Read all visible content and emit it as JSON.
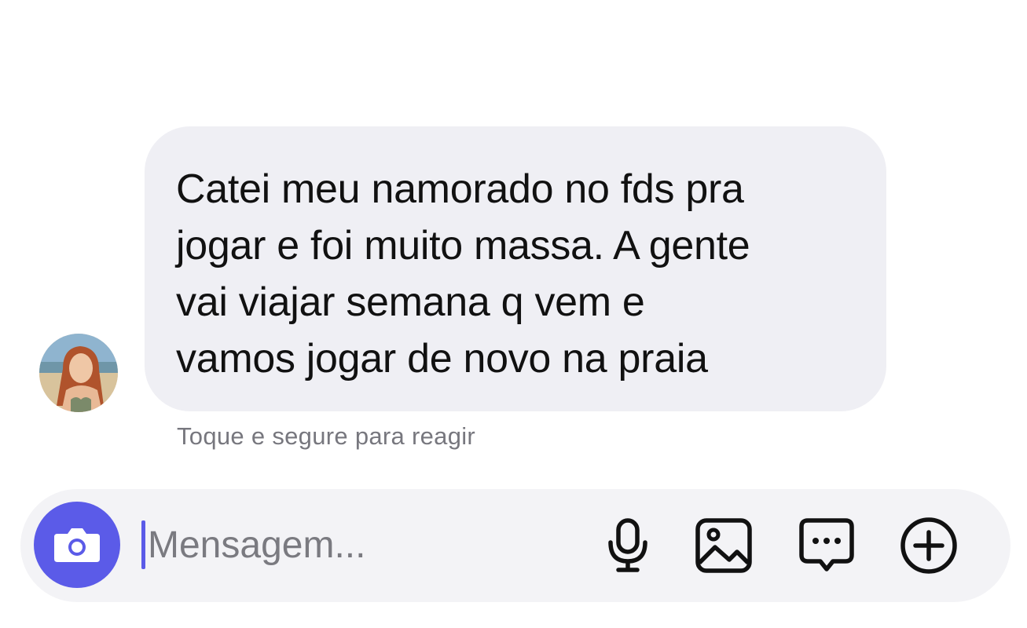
{
  "chat": {
    "message": {
      "text": "Catei meu namorado no fds pra\njogar e foi muito massa. A gente\nvai viajar semana q vem e\nvamos jogar de novo na praia",
      "hint": "Toque e segure para reagir"
    },
    "avatar": {
      "icon": "profile-photo-beach"
    }
  },
  "composer": {
    "placeholder": "Mensagem...",
    "value": "",
    "camera_icon": "camera-icon",
    "actions": [
      {
        "icon": "microphone-icon"
      },
      {
        "icon": "image-icon"
      },
      {
        "icon": "chat-more-icon"
      },
      {
        "icon": "plus-circle-icon"
      }
    ]
  },
  "colors": {
    "accent": "#5b5be8",
    "bubble": "#efeff4",
    "composer": "#f3f3f6",
    "hint": "#77777e"
  }
}
